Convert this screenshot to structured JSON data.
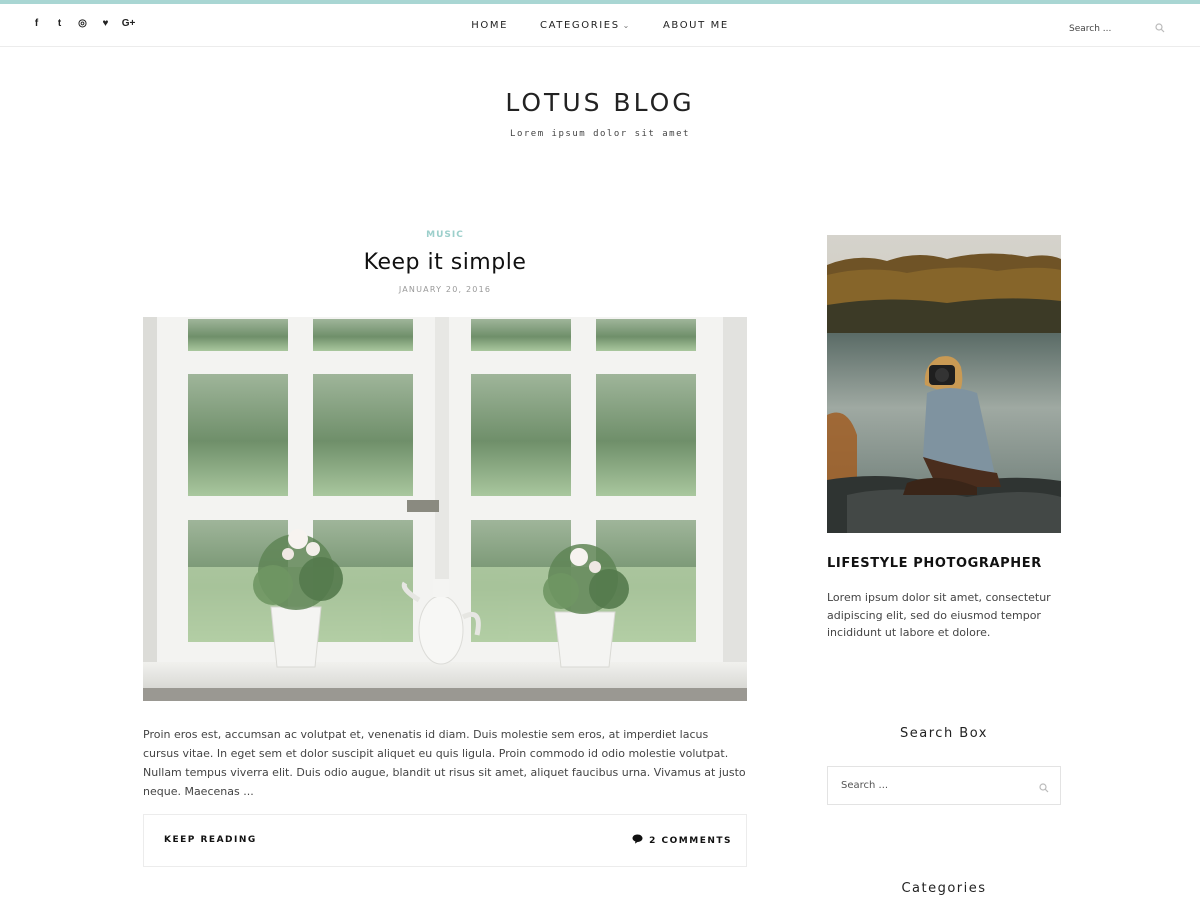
{
  "social": [
    {
      "icon": "facebook-icon",
      "glyph": "f"
    },
    {
      "icon": "twitter-icon",
      "glyph": "t"
    },
    {
      "icon": "instagram-icon",
      "glyph": "◎"
    },
    {
      "icon": "heart-icon",
      "glyph": "♥"
    },
    {
      "icon": "googleplus-icon",
      "glyph": "G+"
    }
  ],
  "nav": {
    "home": "HOME",
    "categories": "CATEGORIES",
    "about": "ABOUT ME"
  },
  "top_search": {
    "placeholder": "Search ..."
  },
  "site": {
    "title": "LOTUS BLOG",
    "tagline": "Lorem ipsum dolor sit amet"
  },
  "post": {
    "category": "MUSIC",
    "title": "Keep it simple",
    "date": "JANUARY 20, 2016",
    "excerpt": "Proin eros est, accumsan ac volutpat et, venenatis id diam. Duis molestie sem eros, at imperdiet lacus cursus vitae. In eget sem et dolor suscipit aliquet eu quis ligula. Proin commodo id odio molestie volutpat. Nullam tempus viverra elit. Duis odio augue, blandit ut risus sit amet, aliquet faucibus urna. Vivamus at justo neque. Maecenas ...",
    "keep_reading": "KEEP READING",
    "comments": "2 COMMENTS"
  },
  "sidebar": {
    "about_title": "LIFESTYLE PHOTOGRAPHER",
    "about_text": "Lorem ipsum dolor sit amet, consectetur adipiscing elit, sed do eiusmod tempor incididunt ut labore et dolore.",
    "search_title": "Search Box",
    "search_placeholder": "Search ...",
    "categories_title": "Categories"
  },
  "colors": {
    "accent": "#a9d6d3",
    "category": "#9ccfcb"
  }
}
